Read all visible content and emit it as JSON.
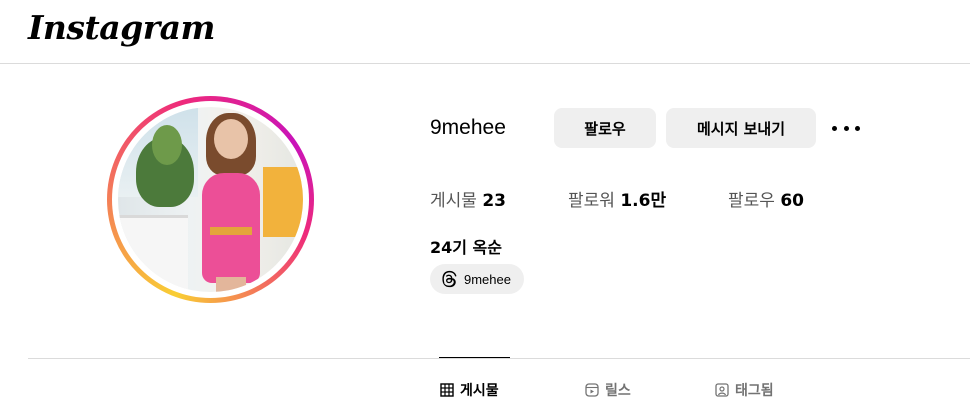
{
  "header": {
    "logo_text": "Instagram"
  },
  "profile": {
    "username": "9mehee",
    "full_name": "24기 옥순",
    "avatar_icon": "profile-photo",
    "story_ring_colors": [
      "#f9ce34",
      "#ee2a7b",
      "#c913b9"
    ],
    "actions": {
      "follow_label": "팔로우",
      "message_label": "메시지 보내기",
      "more_icon": "more-horizontal-icon"
    },
    "stats": {
      "posts_label": "게시물",
      "posts_value": "23",
      "followers_label": "팔로워",
      "followers_value": "1.6만",
      "following_label": "팔로우",
      "following_value": "60"
    },
    "threads": {
      "icon": "threads-icon",
      "label": "9mehee"
    }
  },
  "tabs": [
    {
      "label": "게시물",
      "icon": "grid-icon",
      "active": true
    },
    {
      "label": "릴스",
      "icon": "reels-icon",
      "active": false
    },
    {
      "label": "태그됨",
      "icon": "tagged-icon",
      "active": false
    }
  ],
  "colors": {
    "button_bg": "#efefef",
    "divider": "#dbdbdb",
    "muted_text": "#737373"
  }
}
